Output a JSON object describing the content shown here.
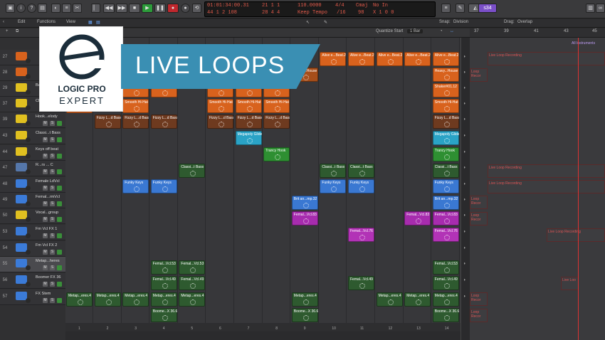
{
  "lcd": {
    "time": "01:01:34:00.31",
    "bars": "44 1 2 108",
    "sub1": "21 1 1",
    "sub2": "28 4 4",
    "tempo": "110.0000",
    "keep": "Keep Tempo",
    "sig": "4/4",
    "div": "/16",
    "key": "Cmaj",
    "val": "98",
    "noin": "No In",
    "xval": "X 1 0 0",
    "user": "s34"
  },
  "menu": [
    "Edit",
    "Functions",
    "View"
  ],
  "quantize": "Quantize Start",
  "quantize_val": "1 Bar",
  "snap": "Snap:",
  "snap_val": "Division",
  "drag": "Drag:",
  "drag_val": "Overlap",
  "ruler": [
    "37",
    "39",
    "41",
    "43",
    "45"
  ],
  "all_instruments": "All Instruments",
  "banner": "LIVE LOOPS",
  "logo": {
    "line1": "LOGIC PRO",
    "line2": "EXPERT"
  },
  "tracks": [
    {
      "num": "27",
      "name": ""
    },
    {
      "num": "28",
      "name": ""
    },
    {
      "num": "29",
      "name": "Bass Stack"
    },
    {
      "num": "37",
      "name": "Chord Stack"
    },
    {
      "num": "39",
      "name": "Hook...elody"
    },
    {
      "num": "43",
      "name": "Classi...t Bass"
    },
    {
      "num": "44",
      "name": "Keys off beat"
    },
    {
      "num": "47",
      "name": "R...rs ... C"
    },
    {
      "num": "48",
      "name": "Female LdVcl"
    },
    {
      "num": "49",
      "name": "Femal...rmVcl"
    },
    {
      "num": "50",
      "name": "Vocal...group"
    },
    {
      "num": "53",
      "name": "Fm Vcl FX 1"
    },
    {
      "num": "54",
      "name": "Fm Vcl FX 2"
    },
    {
      "num": "55",
      "name": "Metap...heres"
    },
    {
      "num": "56",
      "name": "Boomer FX 36"
    },
    {
      "num": "57",
      "name": "FX Stem"
    }
  ],
  "cells": {
    "alive": "Alive e...Beat.2",
    "heavy": "Heavy...House",
    "shaker": "Shaker#01.12",
    "hat": "Smooth Hi-Hat",
    "fizzy": "Fizzy L...d Bass",
    "mega": "Megapoly Glide",
    "trancy": "Trancy Hook",
    "classi": "Classi...t Bass",
    "funky": "Funky Keys",
    "brit": "Brit an...mp.32",
    "femvcl": "Femal...Vcl.83",
    "femvcl76": "Femal...Vcl.76",
    "femvcl53": "Femal...Vcl.53",
    "femvcl49": "Femal...Vcl.49",
    "meta": "Metap...eres.4",
    "boome": "Boome...X 36.6"
  },
  "regions": {
    "rec": "Live Loop Recording",
    "short": "Loop Recor",
    "live": "Live Loo"
  },
  "cols": [
    "1",
    "2",
    "3",
    "4",
    "5",
    "6",
    "7",
    "8",
    "9",
    "10",
    "11",
    "12",
    "13",
    "14"
  ]
}
